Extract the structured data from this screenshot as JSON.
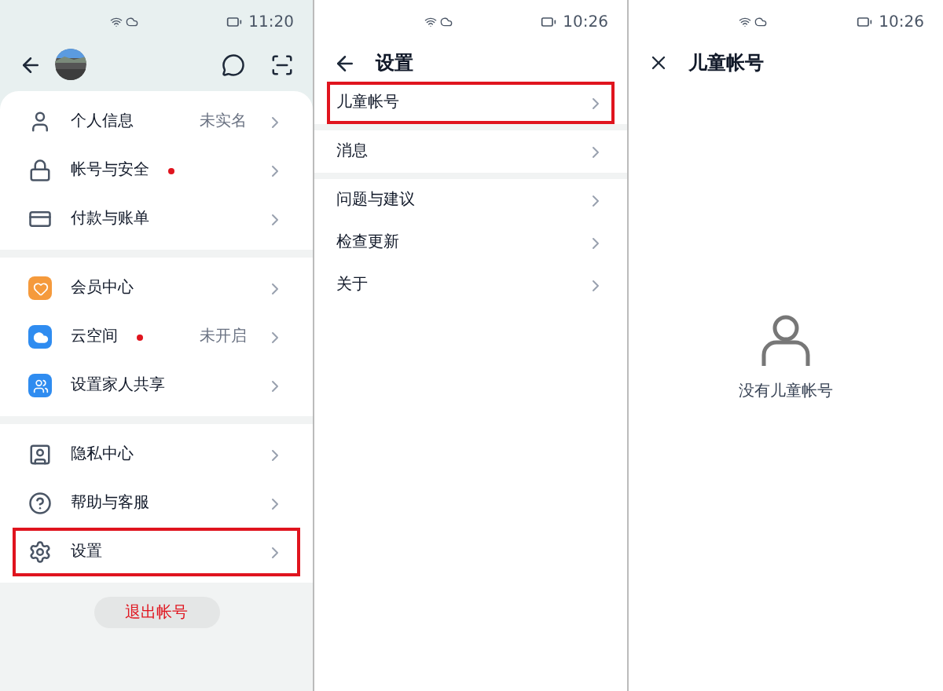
{
  "account_screen": {
    "status_bar": {
      "time": "11:20"
    },
    "groups": [
      [
        {
          "label": "个人信息",
          "kind": "person",
          "value": "未实名",
          "dot": false,
          "highlighted": false
        },
        {
          "label": "帐号与安全",
          "kind": "lock",
          "dot": true,
          "highlighted": false
        },
        {
          "label": "付款与账单",
          "kind": "card",
          "dot": false,
          "highlighted": false
        }
      ],
      [
        {
          "label": "会员中心",
          "kind": "vip",
          "dot": false,
          "highlighted": false
        },
        {
          "label": "云空间",
          "kind": "cloud",
          "value": "未开启",
          "dot": true,
          "highlighted": false
        },
        {
          "label": "设置家人共享",
          "kind": "family",
          "dot": false,
          "highlighted": false
        }
      ],
      [
        {
          "label": "隐私中心",
          "kind": "privacy",
          "dot": false,
          "highlighted": false
        },
        {
          "label": "帮助与客服",
          "kind": "help",
          "dot": false,
          "highlighted": false
        },
        {
          "label": "设置",
          "kind": "gear",
          "dot": false,
          "highlighted": true
        }
      ]
    ],
    "logout_button": "退出帐号"
  },
  "settings_screen": {
    "status_bar": {
      "time": "10:26"
    },
    "title": "设置",
    "groups": [
      [
        {
          "label": "儿童帐号",
          "highlighted": true
        }
      ],
      [
        {
          "label": "消息",
          "highlighted": false
        }
      ],
      [
        {
          "label": "问题与建议",
          "highlighted": false
        },
        {
          "label": "检查更新",
          "highlighted": false
        },
        {
          "label": "关于",
          "highlighted": false
        }
      ]
    ]
  },
  "child_account_screen": {
    "status_bar": {
      "time": "10:26"
    },
    "title": "儿童帐号",
    "empty_message": "没有儿童帐号"
  }
}
